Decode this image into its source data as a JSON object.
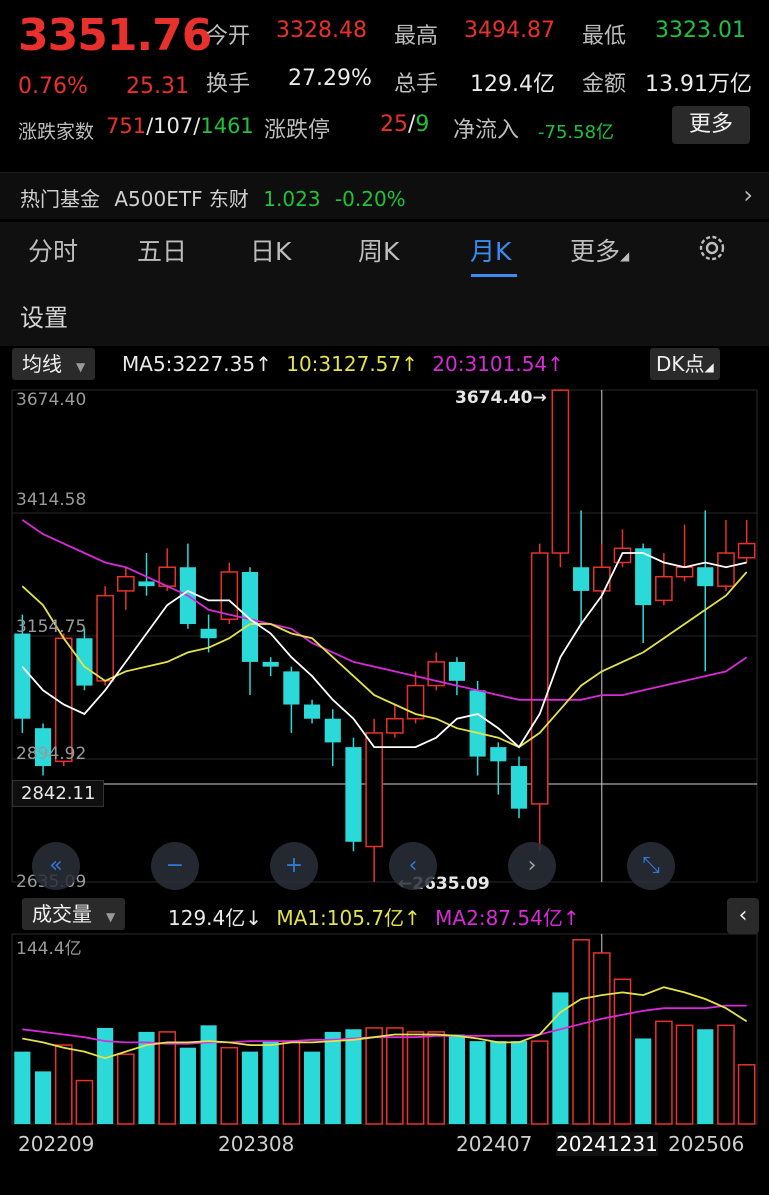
{
  "header": {
    "price": "3351.76",
    "change_pct": "0.76%",
    "change_abs": "25.31",
    "open_label": "今开",
    "open_value": "3328.48",
    "high_label": "最高",
    "high_value": "3494.87",
    "low_label": "最低",
    "low_value": "3323.01",
    "turnover_label": "换手",
    "turnover_value": "27.29%",
    "volume_label": "总手",
    "volume_value": "129.4亿",
    "amount_label": "金额",
    "amount_value": "13.91万亿",
    "breadth_label": "涨跌家数",
    "breadth_up": "751",
    "breadth_flat": "107",
    "breadth_down": "1461",
    "limit_label": "涨跌停",
    "limit_up": "25",
    "limit_down": "9",
    "netflow_label": "净流入",
    "netflow_value": "-75.58亿",
    "more_button": "更多"
  },
  "fund_bar": {
    "label": "热门基金",
    "name": "A500ETF 东财",
    "price": "1.023",
    "change": "-0.20%"
  },
  "tabs": [
    {
      "label": "分时",
      "active": false
    },
    {
      "label": "五日",
      "active": false
    },
    {
      "label": "日K",
      "active": false
    },
    {
      "label": "周K",
      "active": false
    },
    {
      "label": "月K",
      "active": true
    },
    {
      "label": "更多",
      "active": false
    }
  ],
  "settings_label": "设置",
  "indicator": {
    "dropdown_label": "均线",
    "ma5": "MA5:3227.35",
    "ma10": "10:3127.57",
    "ma20": "20:3101.54",
    "dk_label": "DK点",
    "colors": {
      "ma5": "#ffffff",
      "ma10": "#e4e24a",
      "ma20": "#d62bd6"
    }
  },
  "price_axis": {
    "labels": [
      "3674.40",
      "3414.58",
      "3154.75",
      "2894.92",
      "2635.09"
    ],
    "current_marker": "2842.11",
    "max_annotation": "3674.40",
    "min_annotation": "2635.09"
  },
  "volume": {
    "dropdown_label": "成交量",
    "value": "129.4亿",
    "ma1": "MA1:105.7亿",
    "ma2": "MA2:87.54亿",
    "axis_top": "144.4亿"
  },
  "dates": [
    "202209",
    "202308",
    "202407",
    "20241231",
    "202506"
  ],
  "chart_data": {
    "type": "candlestick",
    "ylim": [
      2635.09,
      3674.4
    ],
    "candles": [
      {
        "o": 3160,
        "c": 2980,
        "h": 3200,
        "l": 2950
      },
      {
        "o": 2960,
        "c": 2880,
        "h": 2970,
        "l": 2860
      },
      {
        "o": 2890,
        "c": 3150,
        "h": 3160,
        "l": 2880
      },
      {
        "o": 3150,
        "c": 3050,
        "h": 3170,
        "l": 3040
      },
      {
        "o": 3060,
        "c": 3240,
        "h": 3260,
        "l": 3050
      },
      {
        "o": 3250,
        "c": 3280,
        "h": 3300,
        "l": 3210
      },
      {
        "o": 3270,
        "c": 3260,
        "h": 3330,
        "l": 3240
      },
      {
        "o": 3260,
        "c": 3300,
        "h": 3340,
        "l": 3250
      },
      {
        "o": 3300,
        "c": 3180,
        "h": 3350,
        "l": 3170
      },
      {
        "o": 3170,
        "c": 3150,
        "h": 3200,
        "l": 3120
      },
      {
        "o": 3190,
        "c": 3290,
        "h": 3310,
        "l": 3180
      },
      {
        "o": 3290,
        "c": 3100,
        "h": 3300,
        "l": 3030
      },
      {
        "o": 3100,
        "c": 3090,
        "h": 3110,
        "l": 3070
      },
      {
        "o": 3080,
        "c": 3010,
        "h": 3090,
        "l": 2950
      },
      {
        "o": 3010,
        "c": 2980,
        "h": 3020,
        "l": 2970
      },
      {
        "o": 2980,
        "c": 2930,
        "h": 3000,
        "l": 2880
      },
      {
        "o": 2920,
        "c": 2720,
        "h": 2940,
        "l": 2700
      },
      {
        "o": 2710,
        "c": 2950,
        "h": 2980,
        "l": 2635
      },
      {
        "o": 2950,
        "c": 2980,
        "h": 3010,
        "l": 2940
      },
      {
        "o": 2980,
        "c": 3050,
        "h": 3080,
        "l": 2970
      },
      {
        "o": 3050,
        "c": 3100,
        "h": 3120,
        "l": 3040
      },
      {
        "o": 3100,
        "c": 3060,
        "h": 3110,
        "l": 3030
      },
      {
        "o": 3040,
        "c": 2900,
        "h": 3060,
        "l": 2860
      },
      {
        "o": 2920,
        "c": 2890,
        "h": 2930,
        "l": 2820
      },
      {
        "o": 2880,
        "c": 2790,
        "h": 2900,
        "l": 2770
      },
      {
        "o": 2800,
        "c": 3330,
        "h": 3350,
        "l": 2700
      },
      {
        "o": 3330,
        "c": 3674,
        "h": 3674,
        "l": 3300
      },
      {
        "o": 3300,
        "c": 3250,
        "h": 3420,
        "l": 3180
      },
      {
        "o": 3250,
        "c": 3300,
        "h": 3350,
        "l": 3240
      },
      {
        "o": 3310,
        "c": 3340,
        "h": 3380,
        "l": 3300
      },
      {
        "o": 3340,
        "c": 3220,
        "h": 3350,
        "l": 3140
      },
      {
        "o": 3230,
        "c": 3280,
        "h": 3330,
        "l": 3220
      },
      {
        "o": 3280,
        "c": 3300,
        "h": 3390,
        "l": 3270
      },
      {
        "o": 3300,
        "c": 3260,
        "h": 3420,
        "l": 3080
      },
      {
        "o": 3260,
        "c": 3330,
        "h": 3400,
        "l": 3250
      },
      {
        "o": 3320,
        "c": 3350,
        "h": 3400,
        "l": 3310
      }
    ],
    "ma5": [
      3090,
      3040,
      3010,
      2990,
      3040,
      3100,
      3160,
      3220,
      3250,
      3230,
      3230,
      3190,
      3160,
      3110,
      3070,
      3020,
      2980,
      2920,
      2920,
      2920,
      2940,
      2980,
      2990,
      2960,
      2920,
      2990,
      3110,
      3180,
      3240,
      3330,
      3330,
      3310,
      3300,
      3310,
      3300,
      3310
    ],
    "ma10": [
      3260,
      3220,
      3150,
      3090,
      3060,
      3080,
      3090,
      3100,
      3120,
      3130,
      3150,
      3180,
      3180,
      3160,
      3150,
      3110,
      3070,
      3030,
      3010,
      2990,
      2980,
      2960,
      2950,
      2940,
      2920,
      2950,
      3000,
      3050,
      3080,
      3100,
      3120,
      3150,
      3180,
      3210,
      3240,
      3290
    ],
    "ma20": [
      3400,
      3370,
      3350,
      3330,
      3310,
      3300,
      3280,
      3260,
      3240,
      3210,
      3200,
      3190,
      3180,
      3170,
      3140,
      3120,
      3100,
      3090,
      3080,
      3070,
      3060,
      3050,
      3040,
      3030,
      3020,
      3020,
      3020,
      3020,
      3030,
      3030,
      3040,
      3050,
      3060,
      3070,
      3080,
      3110
    ],
    "volume": {
      "ymax": 144.4,
      "values": [
        55,
        40,
        60,
        33,
        73,
        53,
        70,
        70,
        58,
        75,
        58,
        55,
        63,
        63,
        55,
        70,
        72,
        73,
        73,
        70,
        70,
        68,
        63,
        63,
        63,
        63,
        100,
        140,
        130,
        110,
        65,
        78,
        75,
        72,
        75,
        45
      ],
      "up": [
        false,
        false,
        true,
        true,
        false,
        true,
        false,
        true,
        false,
        false,
        true,
        false,
        false,
        true,
        false,
        false,
        false,
        true,
        true,
        true,
        true,
        false,
        false,
        false,
        false,
        true,
        false,
        true,
        true,
        true,
        false,
        true,
        true,
        false,
        true,
        true
      ],
      "ma1": [
        65,
        62,
        58,
        55,
        50,
        55,
        60,
        62,
        62,
        63,
        62,
        60,
        60,
        62,
        62,
        63,
        64,
        66,
        68,
        68,
        68,
        67,
        65,
        62,
        62,
        68,
        85,
        95,
        98,
        100,
        98,
        104,
        100,
        95,
        88,
        78
      ],
      "ma2": [
        72,
        70,
        68,
        66,
        63,
        62,
        62,
        61,
        61,
        62,
        62,
        63,
        63,
        63,
        64,
        64,
        65,
        66,
        66,
        66,
        67,
        67,
        67,
        67,
        67,
        68,
        72,
        76,
        80,
        83,
        86,
        88,
        88,
        88,
        90,
        90
      ]
    }
  }
}
